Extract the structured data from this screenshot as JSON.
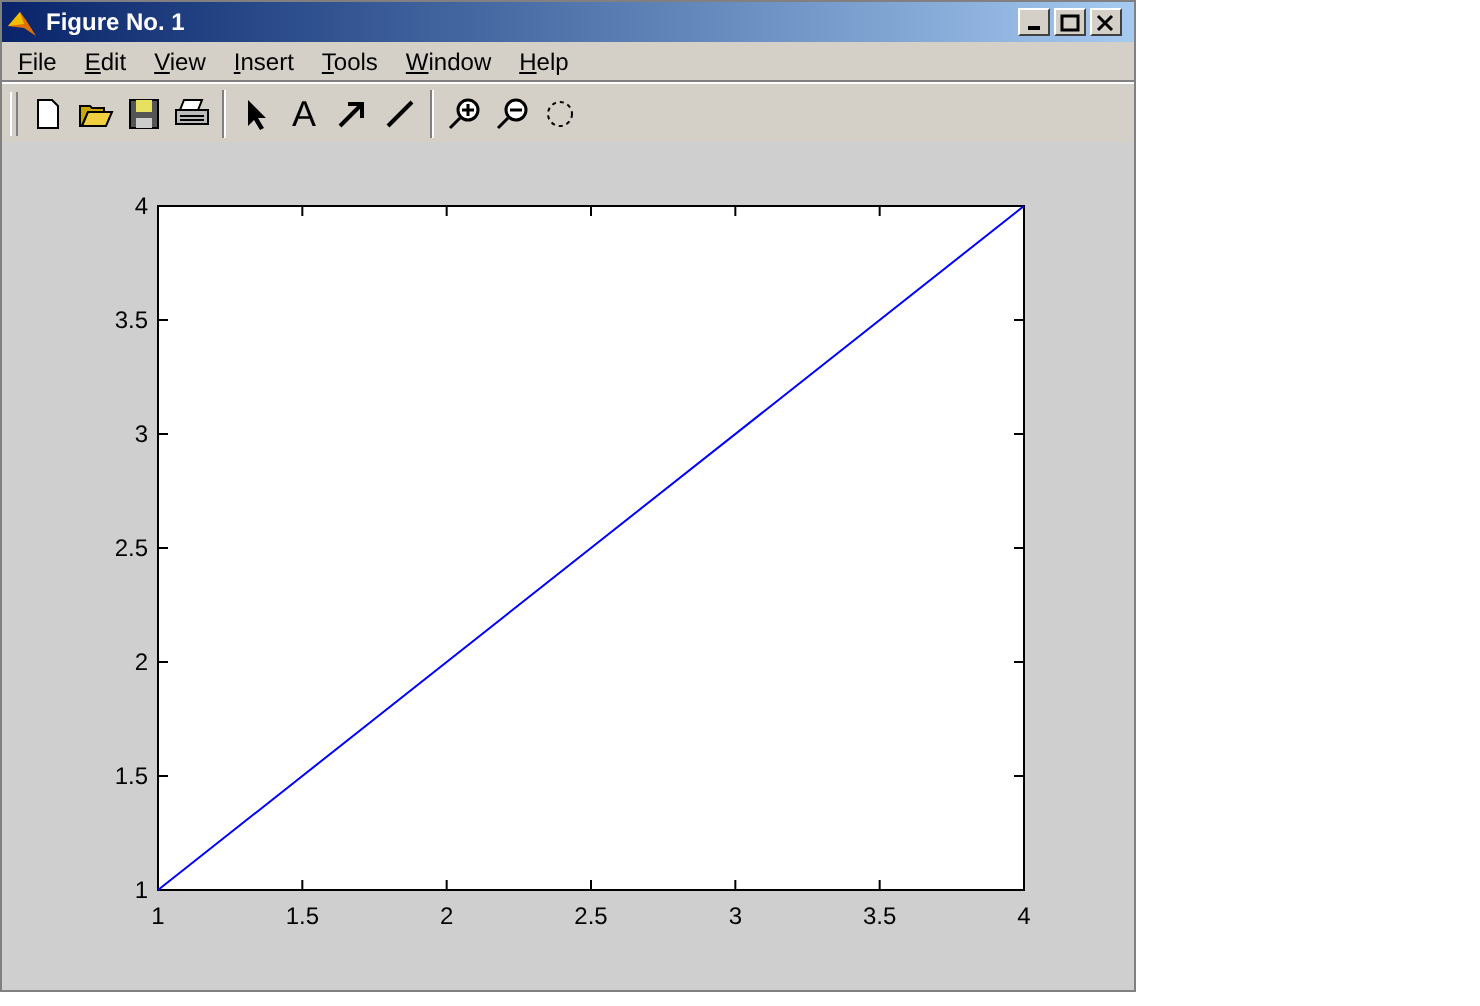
{
  "window": {
    "title": "Figure No. 1"
  },
  "menu": [
    {
      "label": "File"
    },
    {
      "label": "Edit"
    },
    {
      "label": "View"
    },
    {
      "label": "Insert"
    },
    {
      "label": "Tools"
    },
    {
      "label": "Window"
    },
    {
      "label": "Help"
    }
  ],
  "toolbar": [
    {
      "kind": "new"
    },
    {
      "kind": "open"
    },
    {
      "kind": "save"
    },
    {
      "kind": "print"
    },
    {
      "kind": "separator"
    },
    {
      "kind": "pointer"
    },
    {
      "kind": "text",
      "label": "A"
    },
    {
      "kind": "arrow"
    },
    {
      "kind": "line"
    },
    {
      "kind": "separator"
    },
    {
      "kind": "zoom-in"
    },
    {
      "kind": "zoom-out"
    },
    {
      "kind": "rotate"
    }
  ],
  "plot": {
    "chart_data": {
      "type": "line",
      "x": [
        1,
        4
      ],
      "series": [
        {
          "color": "#0000ff",
          "values": [
            1,
            4
          ]
        }
      ],
      "xlim": [
        1,
        4
      ],
      "ylim": [
        1,
        4
      ],
      "xticks": [
        1,
        1.5,
        2,
        2.5,
        3,
        3.5,
        4
      ],
      "yticks": [
        1,
        1.5,
        2,
        2.5,
        3,
        3.5,
        4
      ]
    }
  }
}
